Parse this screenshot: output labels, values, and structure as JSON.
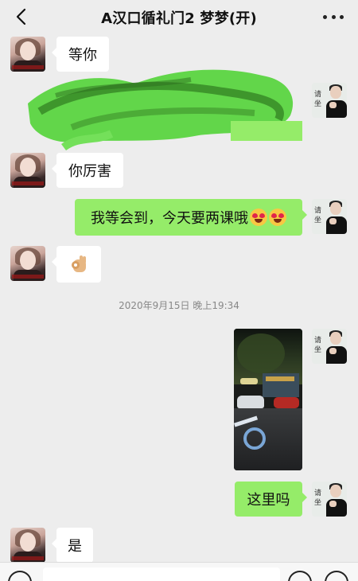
{
  "header": {
    "title": "A汉口循礼门2  梦梦(开)"
  },
  "avatar_right": {
    "chars": "请\n坐"
  },
  "messages": {
    "m1": "等你",
    "m3": "你厉害",
    "m4": "我等会到，今天要两课哦",
    "m9": "这里吗",
    "m10": "是"
  },
  "timestamp": "2020年9月15日 晚上19:34",
  "icons": {
    "back": "chevron-left-icon",
    "more": "more-icon",
    "emoji": "heart-eyes-emoji",
    "ok": "ok-hand-emoji"
  },
  "colors": {
    "outgoing_bubble": "#95ec69",
    "incoming_bubble": "#ffffff",
    "background": "#ededed"
  }
}
